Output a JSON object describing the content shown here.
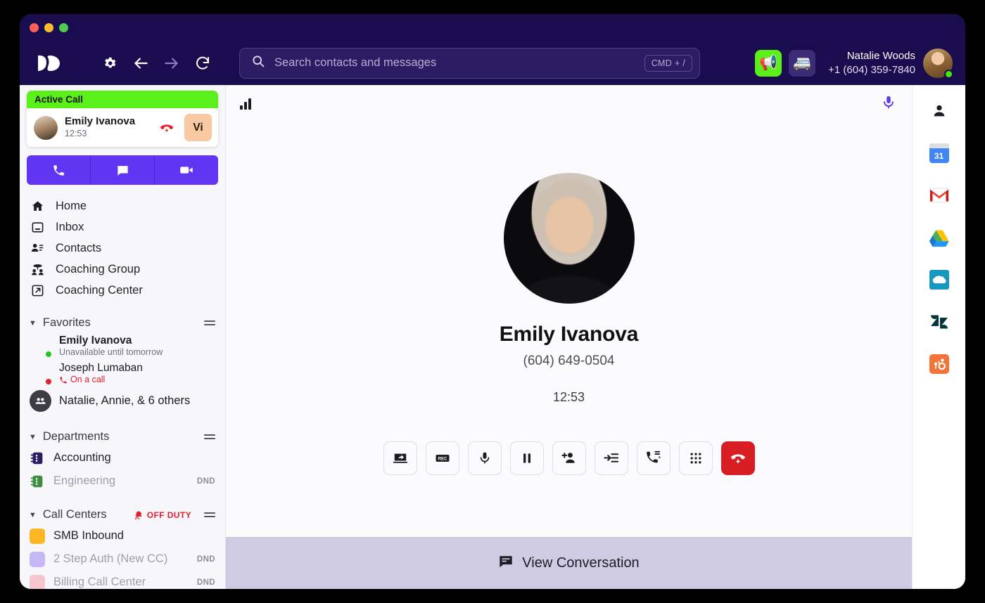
{
  "window": {
    "traffic_lights": [
      "close",
      "minimize",
      "maximize"
    ]
  },
  "toolbar": {
    "logo_name": "dialpad-logo",
    "settings_label": "Settings",
    "back_label": "Back",
    "forward_label": "Forward",
    "reload_label": "Reload",
    "search": {
      "placeholder": "Search contacts and messages",
      "shortcut": "CMD + /"
    },
    "apps": [
      {
        "name": "announcement-icon",
        "glyph": "📢",
        "style": "green"
      },
      {
        "name": "van-icon",
        "glyph": "🚐",
        "style": "purple"
      }
    ],
    "user": {
      "name": "Natalie Woods",
      "phone": "+1 (604) 359-7840",
      "presence": "available",
      "presence_color": "#44E80B"
    }
  },
  "sidebar": {
    "active_call": {
      "header": "Active Call",
      "header_color": "#5BF01A",
      "contact_name": "Emily Ivanova",
      "timer": "12:53",
      "hangup_icon": "hangup-icon",
      "badge_label": "Vi",
      "badge_color": "#F9C9A3"
    },
    "quick_actions": [
      {
        "name": "quick-call-button",
        "icon": "phone-icon"
      },
      {
        "name": "quick-message-button",
        "icon": "message-icon"
      },
      {
        "name": "quick-video-button",
        "icon": "video-icon"
      }
    ],
    "nav_items": [
      {
        "label": "Home",
        "icon": "home-icon"
      },
      {
        "label": "Inbox",
        "icon": "inbox-icon"
      },
      {
        "label": "Contacts",
        "icon": "contacts-icon"
      },
      {
        "label": "Coaching Group",
        "icon": "coaching-group-icon"
      },
      {
        "label": "Coaching Center",
        "icon": "coaching-center-icon"
      }
    ],
    "favorites": {
      "title": "Favorites",
      "caret": "▼",
      "items": [
        {
          "name": "Emily Ivanova",
          "status": "Unavailable until tomorrow",
          "presence": "green",
          "bold": true,
          "avatar": "emily"
        },
        {
          "name": "Joseph Lumaban",
          "status": "On a call",
          "status_style": "on-call",
          "presence": "red",
          "bold": false,
          "avatar": "joseph"
        },
        {
          "name": "Natalie, Annie, & 6 others",
          "status": "",
          "presence": "none",
          "bold": false,
          "avatar": "group"
        }
      ]
    },
    "departments": {
      "title": "Departments",
      "caret": "▼",
      "items": [
        {
          "label": "Accounting",
          "color": "#2B1C63",
          "dnd": "",
          "dim": false
        },
        {
          "label": "Engineering",
          "color": "#3E8E41",
          "dnd": "DND",
          "dim": true
        }
      ]
    },
    "call_centers": {
      "title": "Call Centers",
      "caret": "▼",
      "off_duty_label": "OFF DUTY",
      "off_duty_color": "#E5202A",
      "items": [
        {
          "label": "SMB Inbound",
          "color": "#FBB724",
          "dnd": "",
          "dim": false
        },
        {
          "label": "2 Step Auth (New CC)",
          "color": "#C5B8F5",
          "dnd": "DND",
          "dim": true
        },
        {
          "label": "Billing Call Center",
          "color": "#F5C5D0",
          "dnd": "DND",
          "dim": true
        }
      ]
    }
  },
  "call": {
    "signal_icon": "signal-strength-icon",
    "mic_icon": "microphone-icon",
    "mic_color": "#6136F2",
    "callee_name": "Emily Ivanova",
    "callee_phone": "(604) 649-0504",
    "timer": "12:53",
    "controls": [
      {
        "name": "screen-share-button",
        "icon": "screen-share-icon"
      },
      {
        "name": "record-button",
        "icon": "record-icon"
      },
      {
        "name": "mute-button",
        "icon": "microphone-icon"
      },
      {
        "name": "hold-button",
        "icon": "pause-icon"
      },
      {
        "name": "add-participant-button",
        "icon": "add-person-icon"
      },
      {
        "name": "transfer-button",
        "icon": "transfer-icon"
      },
      {
        "name": "call-flip-button",
        "icon": "call-flip-icon"
      },
      {
        "name": "keypad-button",
        "icon": "keypad-icon"
      },
      {
        "name": "end-call-button",
        "icon": "hangup-icon",
        "color": "#D81E22"
      }
    ]
  },
  "bottom_bar": {
    "label": "View Conversation",
    "icon": "conversation-icon",
    "background": "#CFCBE2"
  },
  "right_rail": [
    {
      "name": "rail-contact-icon",
      "label": "Contact"
    },
    {
      "name": "rail-google-calendar-icon",
      "label": "Google Calendar",
      "day": "31"
    },
    {
      "name": "rail-gmail-icon",
      "label": "Gmail"
    },
    {
      "name": "rail-google-drive-icon",
      "label": "Google Drive"
    },
    {
      "name": "rail-salesforce-icon",
      "label": "Salesforce"
    },
    {
      "name": "rail-zendesk-icon",
      "label": "Zendesk"
    },
    {
      "name": "rail-hubspot-icon",
      "label": "HubSpot"
    }
  ]
}
